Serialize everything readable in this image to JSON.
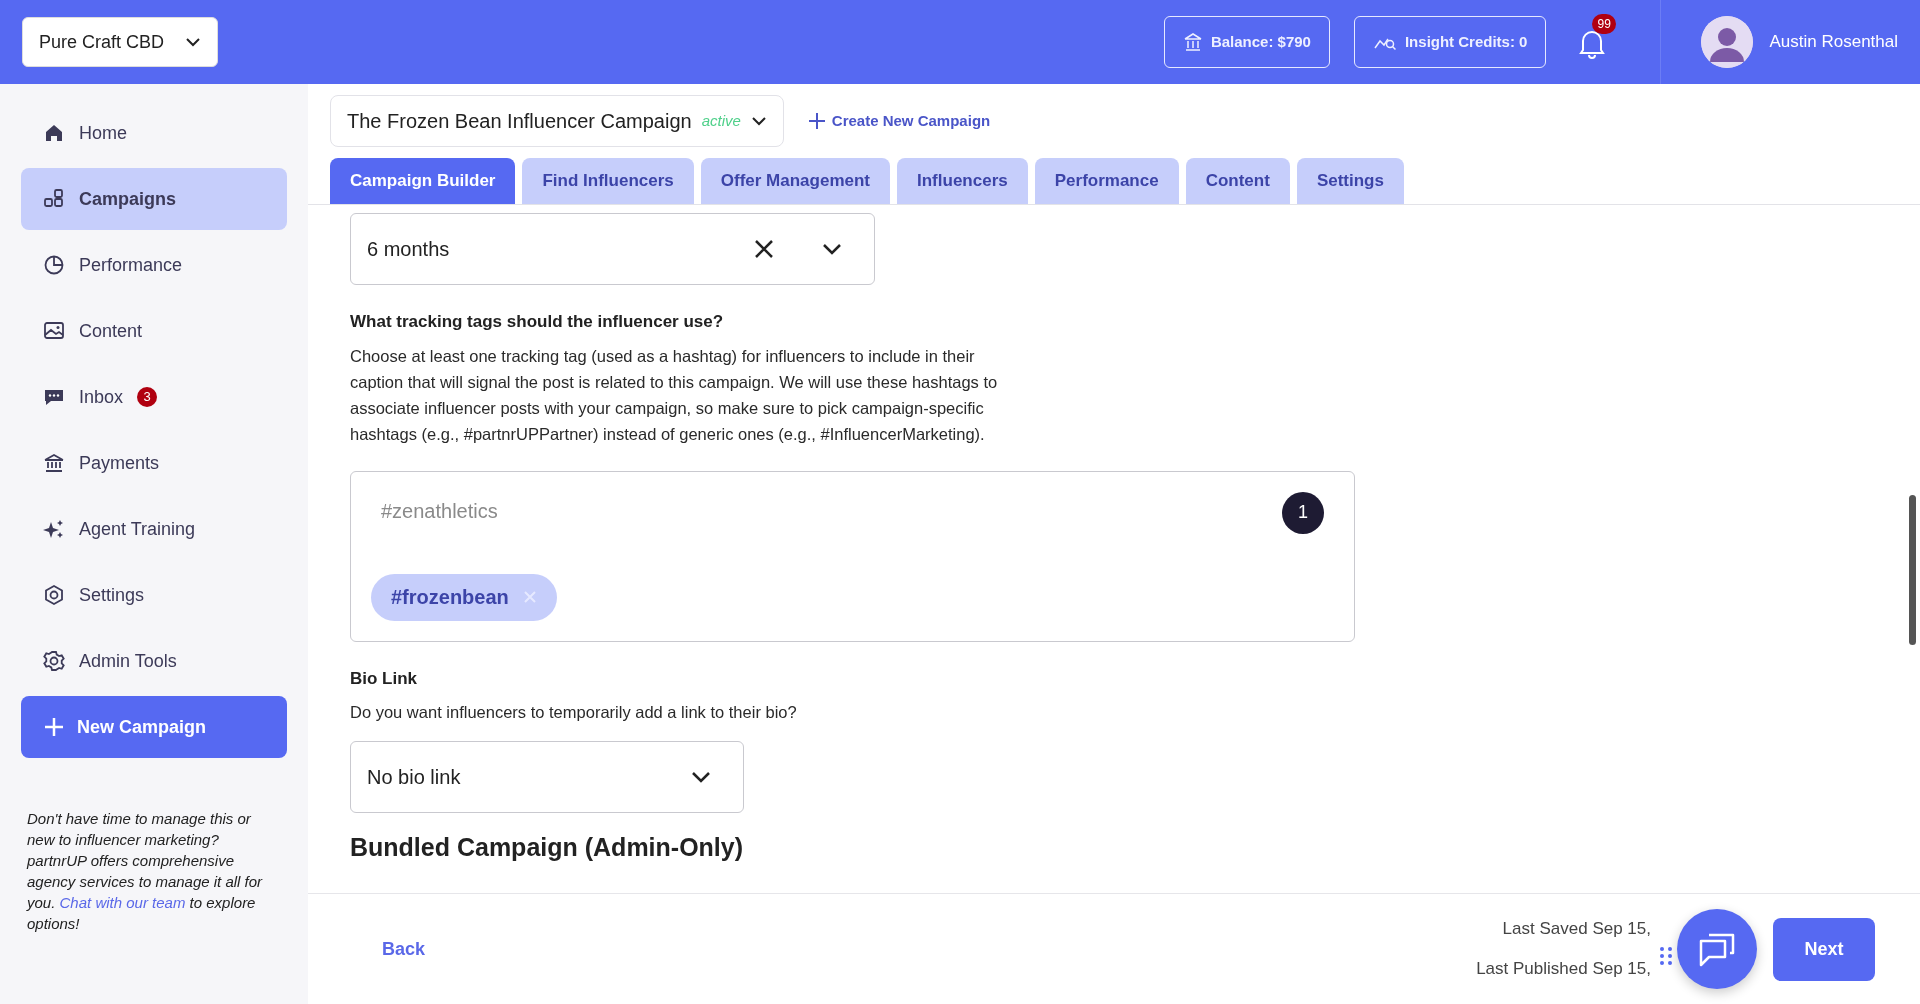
{
  "store_selector": {
    "value": "Pure Craft CBD"
  },
  "header": {
    "balance": "Balance: $790",
    "insight_credits": "Insight Credits: 0",
    "notifications_count": "99",
    "user_name": "Austin Rosenthal"
  },
  "sidebar": {
    "items": [
      {
        "label": "Home",
        "selected": false
      },
      {
        "label": "Campaigns",
        "selected": true
      },
      {
        "label": "Performance",
        "selected": false
      },
      {
        "label": "Content",
        "selected": false
      },
      {
        "label": "Inbox",
        "selected": false,
        "badge": "3"
      },
      {
        "label": "Payments",
        "selected": false
      },
      {
        "label": "Agent Training",
        "selected": false
      },
      {
        "label": "Settings",
        "selected": false
      },
      {
        "label": "Admin Tools",
        "selected": false
      }
    ],
    "new_campaign_button": "New Campaign",
    "promo": {
      "text_before": "Don't have time to manage this or new to influencer marketing? partnrUP offers comprehensive agency services to manage it all for you. ",
      "link": "Chat with our team",
      "text_after": " to explore options!"
    }
  },
  "campaign": {
    "name": "The Frozen Bean Influencer Campaign",
    "status": "active"
  },
  "create_campaign_link": "Create New Campaign",
  "tabs": [
    {
      "label": "Campaign Builder",
      "selected": true
    },
    {
      "label": "Find Influencers",
      "selected": false
    },
    {
      "label": "Offer Management",
      "selected": false
    },
    {
      "label": "Influencers",
      "selected": false
    },
    {
      "label": "Performance",
      "selected": false
    },
    {
      "label": "Content",
      "selected": false
    },
    {
      "label": "Settings",
      "selected": false
    }
  ],
  "form": {
    "duration_select": {
      "value": "6 months"
    },
    "tracking_tags": {
      "question": "What tracking tags should the influencer use?",
      "description": "Choose at least one tracking tag (used as a hashtag) for influencers to include in their caption that will signal the post is related to this campaign. We will use these hashtags to associate influencer posts with your campaign, so make sure to pick campaign-specific hashtags (e.g., #partnrUPPartner) instead of generic ones (e.g., #InfluencerMarketing).",
      "placeholder": "#zenathletics",
      "count": "1",
      "tags": [
        "#frozenbean"
      ]
    },
    "bio_link": {
      "label": "Bio Link",
      "question": "Do you want influencers to temporarily add a link to their bio?",
      "value": "No bio link"
    },
    "section_heading": "Bundled Campaign (Admin-Only)"
  },
  "footer": {
    "back": "Back",
    "last_saved": "Last Saved Sep 15,",
    "last_published": "Last Published Sep 15,",
    "next": "Next"
  }
}
